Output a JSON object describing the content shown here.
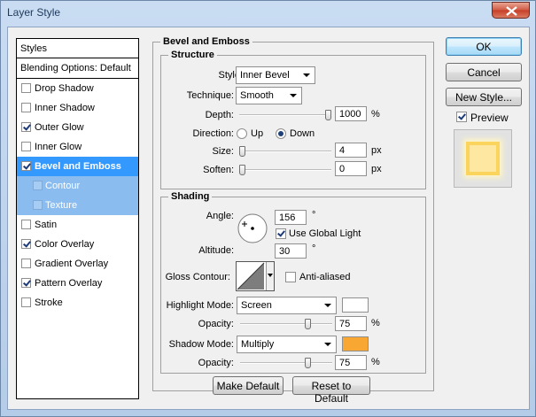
{
  "window": {
    "title": "Layer Style"
  },
  "styles_panel": {
    "header": "Styles",
    "blending": "Blending Options: Default",
    "items": [
      {
        "label": "Drop Shadow",
        "checked": false
      },
      {
        "label": "Inner Shadow",
        "checked": false
      },
      {
        "label": "Outer Glow",
        "checked": true
      },
      {
        "label": "Inner Glow",
        "checked": false
      },
      {
        "label": "Bevel and Emboss",
        "checked": true
      },
      {
        "label": "Contour",
        "checked": false
      },
      {
        "label": "Texture",
        "checked": false
      },
      {
        "label": "Satin",
        "checked": false
      },
      {
        "label": "Color Overlay",
        "checked": true
      },
      {
        "label": "Gradient Overlay",
        "checked": false
      },
      {
        "label": "Pattern Overlay",
        "checked": true
      },
      {
        "label": "Stroke",
        "checked": false
      }
    ]
  },
  "bevel": {
    "title": "Bevel and Emboss",
    "structure": {
      "title": "Structure",
      "style_label": "Style:",
      "style_value": "Inner Bevel",
      "technique_label": "Technique:",
      "technique_value": "Smooth",
      "depth_label": "Depth:",
      "depth_value": "1000",
      "depth_unit": "%",
      "direction_label": "Direction:",
      "direction_up": "Up",
      "direction_down": "Down",
      "direction_selected": "Down",
      "size_label": "Size:",
      "size_value": "4",
      "size_unit": "px",
      "soften_label": "Soften:",
      "soften_value": "0",
      "soften_unit": "px"
    },
    "shading": {
      "title": "Shading",
      "angle_label": "Angle:",
      "angle_value": "156",
      "angle_unit": "°",
      "global_light_label": "Use Global Light",
      "global_light_checked": true,
      "altitude_label": "Altitude:",
      "altitude_value": "30",
      "altitude_unit": "°",
      "gloss_label": "Gloss Contour:",
      "anti_aliased_label": "Anti-aliased",
      "anti_aliased_checked": false,
      "highlight_label": "Highlight Mode:",
      "highlight_value": "Screen",
      "highlight_color": "#ffffff",
      "highlight_opacity_label": "Opacity:",
      "highlight_opacity_value": "75",
      "highlight_opacity_unit": "%",
      "shadow_label": "Shadow Mode:",
      "shadow_value": "Multiply",
      "shadow_color": "#f8a832",
      "shadow_opacity_label": "Opacity:",
      "shadow_opacity_value": "75",
      "shadow_opacity_unit": "%"
    },
    "make_default": "Make Default",
    "reset_default": "Reset to Default"
  },
  "actions": {
    "ok": "OK",
    "cancel": "Cancel",
    "new_style": "New Style...",
    "preview_label": "Preview",
    "preview_checked": true
  },
  "slider_levels": {
    "depth": 1.0,
    "size": 0.0,
    "soften": 0.0,
    "highlight_opacity": 0.75,
    "shadow_opacity": 0.75
  }
}
